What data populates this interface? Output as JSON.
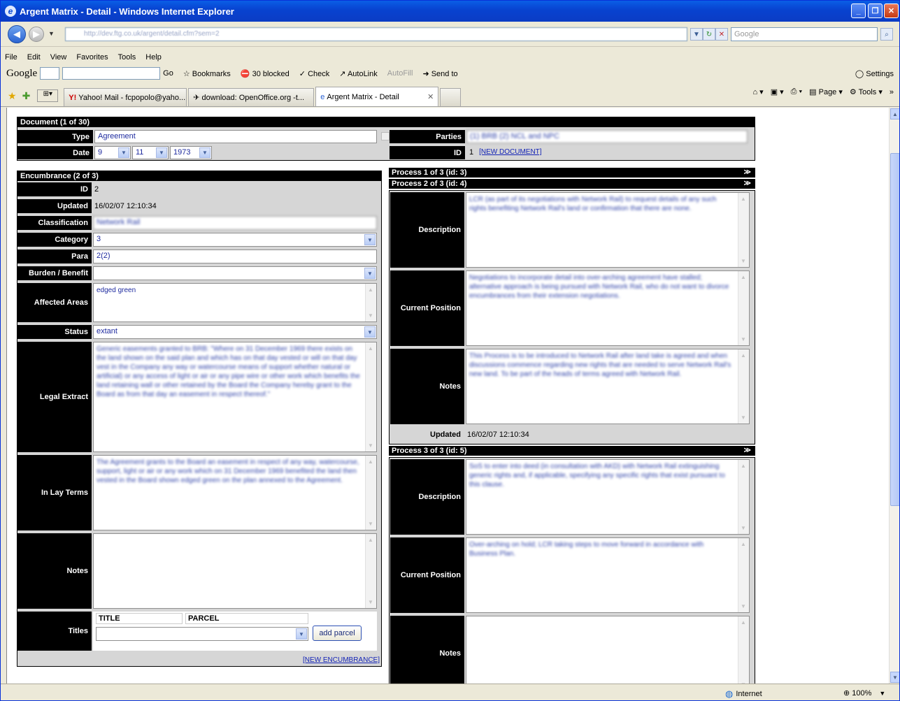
{
  "window": {
    "title": "Argent Matrix - Detail - Windows Internet Explorer"
  },
  "address": {
    "url": "http://dev.ftg.co.uk/argent/detail.cfm?sem=2",
    "search_placeholder": "Google"
  },
  "menu": [
    "File",
    "Edit",
    "View",
    "Favorites",
    "Tools",
    "Help"
  ],
  "google_toolbar": {
    "logo": "Google",
    "go": "Go",
    "bookmarks": "Bookmarks",
    "blocked": "30 blocked",
    "check": "Check",
    "autolink": "AutoLink",
    "autofill": "AutoFill",
    "sendto": "Send to",
    "settings": "Settings"
  },
  "tabs": [
    {
      "label": "Yahoo! Mail - fcpopolo@yaho..."
    },
    {
      "label": "download: OpenOffice.org -t..."
    },
    {
      "label": "Argent Matrix - Detail"
    }
  ],
  "commands": {
    "page": "Page",
    "tools": "Tools"
  },
  "document": {
    "header": "Document (1 of 30)",
    "type_label": "Type",
    "type_value": "Agreement",
    "date_label": "Date",
    "day": "9",
    "month": "11",
    "year": "1973",
    "parties_label": "Parties",
    "parties_value": "(1) BRB (2) NCL and NPC",
    "id_label": "ID",
    "id_value": "1",
    "new_document": "[NEW DOCUMENT]"
  },
  "encumbrance": {
    "header": "Encumbrance (2 of 3)",
    "id_label": "ID",
    "id_value": "2",
    "updated_label": "Updated",
    "updated_value": "16/02/07 12:10:34",
    "classification_label": "Classification",
    "classification_value": "Network Rail",
    "category_label": "Category",
    "category_value": "3",
    "para_label": "Para",
    "para_value": "2(2)",
    "burden_label": "Burden / Benefit",
    "burden_value": "",
    "affected_label": "Affected Areas",
    "affected_value": "edged green",
    "status_label": "Status",
    "status_value": "extant",
    "legal_label": "Legal Extract",
    "legal_value": "Generic easements granted to BRB: \"Where on 31 December 1969 there exists on the land shown on the said plan and which has on that day vested or will on that day vest in the Company any way or watercourse means of support whether natural or artificial) or any access of light or air or any pipe wire or other work which benefits the land retaining wall or other retained by the Board the Company hereby grant to the Board as from that day an easement in respect thereof.\"",
    "laylabel": "In Lay Terms",
    "lay_value": "The Agreement grants to the Board an easement in respect of any way, watercourse, support, light or air or any work which on 31 December 1969 benefited the land then vested in the Board shown edged green on the plan annexed to the Agreement.",
    "notes_label": "Notes",
    "notes_value": "",
    "titles_label": "Titles",
    "title_col": "TITLE",
    "parcel_col": "PARCEL",
    "add_parcel": "add parcel",
    "new_encumbrance": "[NEW ENCUMBRANCE]"
  },
  "processes": [
    {
      "header": "Process 1 of 3 (id: 3)"
    },
    {
      "header": "Process 2 of 3 (id: 4)",
      "description_label": "Description",
      "description_value": "LCR (as part of its negotiations with Network Rail) to request details of any such rights benefiting Network Rail's land or confirmation that there are none.",
      "position_label": "Current Position",
      "position_value": "Negotiations to incorporate detail into over-arching agreement have stalled; alternative approach is being pursued with Network Rail, who do not want to divorce encumbrances from their extension negotiations.",
      "notes_label": "Notes",
      "notes_value": "This Process is to be introduced to Network Rail after land take is agreed and when discussions commence regarding new rights that are needed to serve Network Rail's new land. To be part of the heads of terms agreed with Network Rail.",
      "updated_label": "Updated",
      "updated_value": "16/02/07 12:10:34"
    },
    {
      "header": "Process 3 of 3 (id: 5)",
      "description_label": "Description",
      "description_value": "SoS to enter into deed (in consultation with AKD) with Network Rail extinguishing generic rights and, if applicable, specifying any specific rights that exist pursuant to this clause.",
      "position_label": "Current Position",
      "position_value": "Over-arching on hold; LCR taking steps to move forward in accordance with Business Plan.",
      "notes_label": "Notes",
      "notes_value": ""
    }
  ],
  "status": {
    "zone": "Internet",
    "zoom": "100%"
  }
}
